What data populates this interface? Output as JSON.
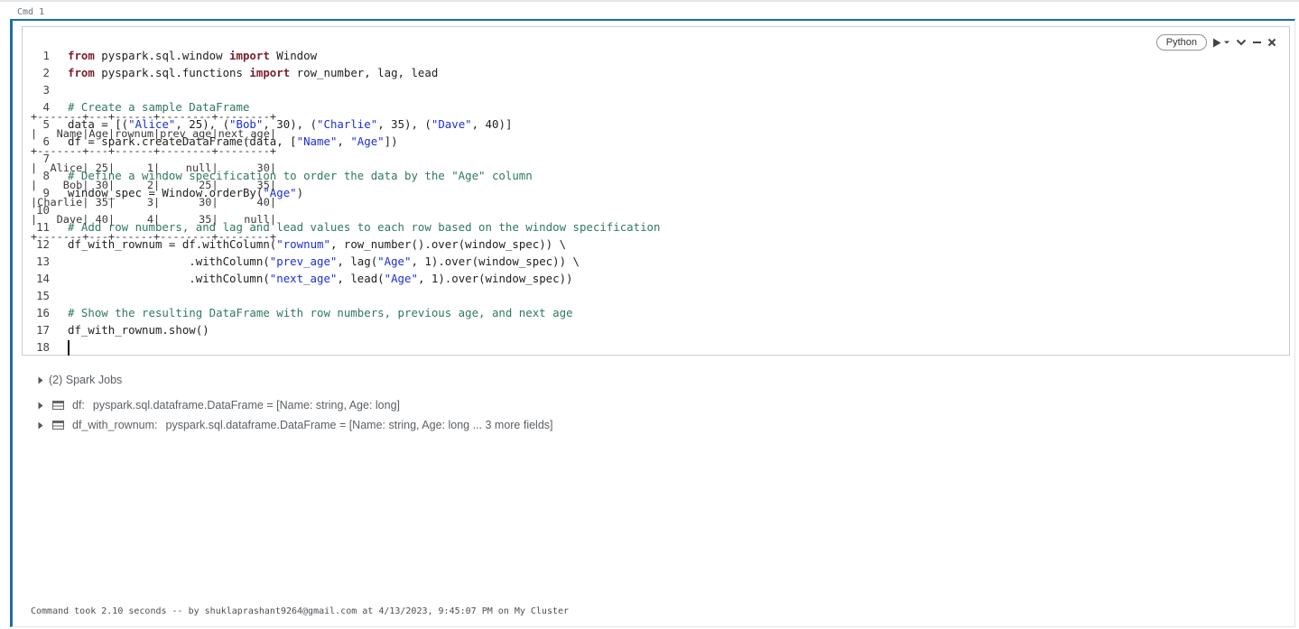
{
  "cell": {
    "label": "Cmd 1",
    "language": "Python",
    "code_lines": [
      "1",
      "2",
      "3",
      "4",
      "5",
      "6",
      "7",
      "8",
      "9",
      "10",
      "11",
      "12",
      "13",
      "14",
      "15",
      "16",
      "17",
      "18"
    ]
  },
  "output": {
    "jobs": "(2) Spark Jobs",
    "schemas": [
      {
        "name": "df:",
        "type": "pyspark.sql.dataframe.DataFrame = [Name: string, Age: long]"
      },
      {
        "name": "df_with_rownum:",
        "type": "pyspark.sql.dataframe.DataFrame = [Name: string, Age: long ... 3 more fields]"
      }
    ],
    "table": {
      "columns": [
        "Name",
        "Age",
        "rownum",
        "prev_age",
        "next_age"
      ],
      "rows": [
        [
          "Alice",
          "25",
          "1",
          "null",
          "30"
        ],
        [
          "Bob",
          "30",
          "2",
          "25",
          "35"
        ],
        [
          "Charlie",
          "35",
          "3",
          "30",
          "40"
        ],
        [
          "Dave",
          "40",
          "4",
          "35",
          "null"
        ]
      ]
    },
    "status": "Command took 2.10 seconds -- by shuklaprashant9264@gmail.com at 4/13/2023, 9:45:07 PM on My Cluster"
  },
  "colors": {
    "accent": "#1b6fa8",
    "keyword": "#7a1f2d",
    "string": "#1c2fd6",
    "comment": "#2f7a5b"
  },
  "icons": [
    "play-icon",
    "dropdown-icon",
    "collapse-icon",
    "minimize-icon",
    "close-icon",
    "expand-triangle-icon",
    "table-icon"
  ]
}
